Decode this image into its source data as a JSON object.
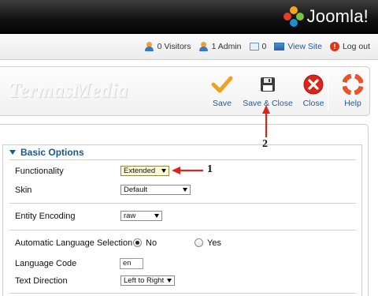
{
  "brand": {
    "logo_text": "Joomla!"
  },
  "status": {
    "visitors": "0 Visitors",
    "admins": "1 Admin",
    "messages": "0",
    "view_site": "View Site",
    "logout": "Log out"
  },
  "toolbar": {
    "watermark": "TermasMedia",
    "save": "Save",
    "save_close": "Save & Close",
    "close": "Close",
    "help": "Help"
  },
  "section": {
    "title": "Basic Options"
  },
  "fields": {
    "functionality": {
      "label": "Functionality",
      "value": "Extended"
    },
    "skin": {
      "label": "Skin",
      "value": "Default"
    },
    "entity_encoding": {
      "label": "Entity Encoding",
      "value": "raw"
    },
    "auto_language": {
      "label": "Automatic Language Selection",
      "option_no": "No",
      "option_yes": "Yes",
      "selected": "No"
    },
    "language_code": {
      "label": "Language Code",
      "value": "en"
    },
    "text_direction": {
      "label": "Text Direction",
      "value": "Left to Right"
    }
  },
  "annotations": {
    "one": "1",
    "two": "2"
  },
  "colors": {
    "accent_red": "#d8261c",
    "save_orange": "#f0a21e",
    "link_blue": "#1a5aa8",
    "section_blue": "#145a8c"
  }
}
